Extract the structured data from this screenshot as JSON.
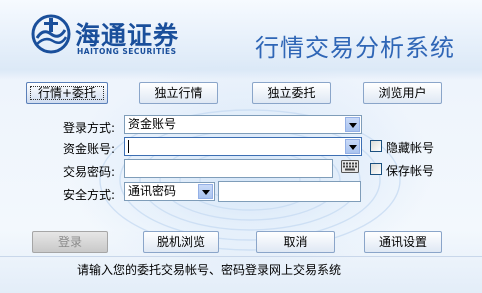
{
  "header": {
    "logo_cn": "海通证券",
    "logo_en": "HAITONG SECURITIES",
    "app_title": "行情交易分析系统"
  },
  "mode_tabs": [
    {
      "label": "行情+委托",
      "active": true
    },
    {
      "label": "独立行情",
      "active": false
    },
    {
      "label": "独立委托",
      "active": false
    },
    {
      "label": "浏览用户",
      "active": false
    }
  ],
  "form": {
    "login_type_label": "登录方式:",
    "login_type_value": "资金账号",
    "account_label": "资金账号:",
    "account_value": "",
    "password_label": "交易密码:",
    "password_value": "",
    "security_label": "安全方式:",
    "security_value": "通讯密码",
    "security_input_value": "",
    "hide_account_label": "隐藏帐号",
    "save_account_label": "保存帐号",
    "hide_account_checked": false,
    "save_account_checked": false
  },
  "actions": {
    "login": "登录",
    "offline": "脱机浏览",
    "cancel": "取消",
    "comm_settings": "通讯设置"
  },
  "status_text": "请输入您的委托交易帐号、密码登录网上交易系统",
  "colors": {
    "brand": "#1a4f9b",
    "title": "#2f66b6",
    "field_border": "#7f9db9"
  },
  "icons": [
    "haitong-logo-icon",
    "keyboard-icon",
    "chevron-down-icon"
  ]
}
